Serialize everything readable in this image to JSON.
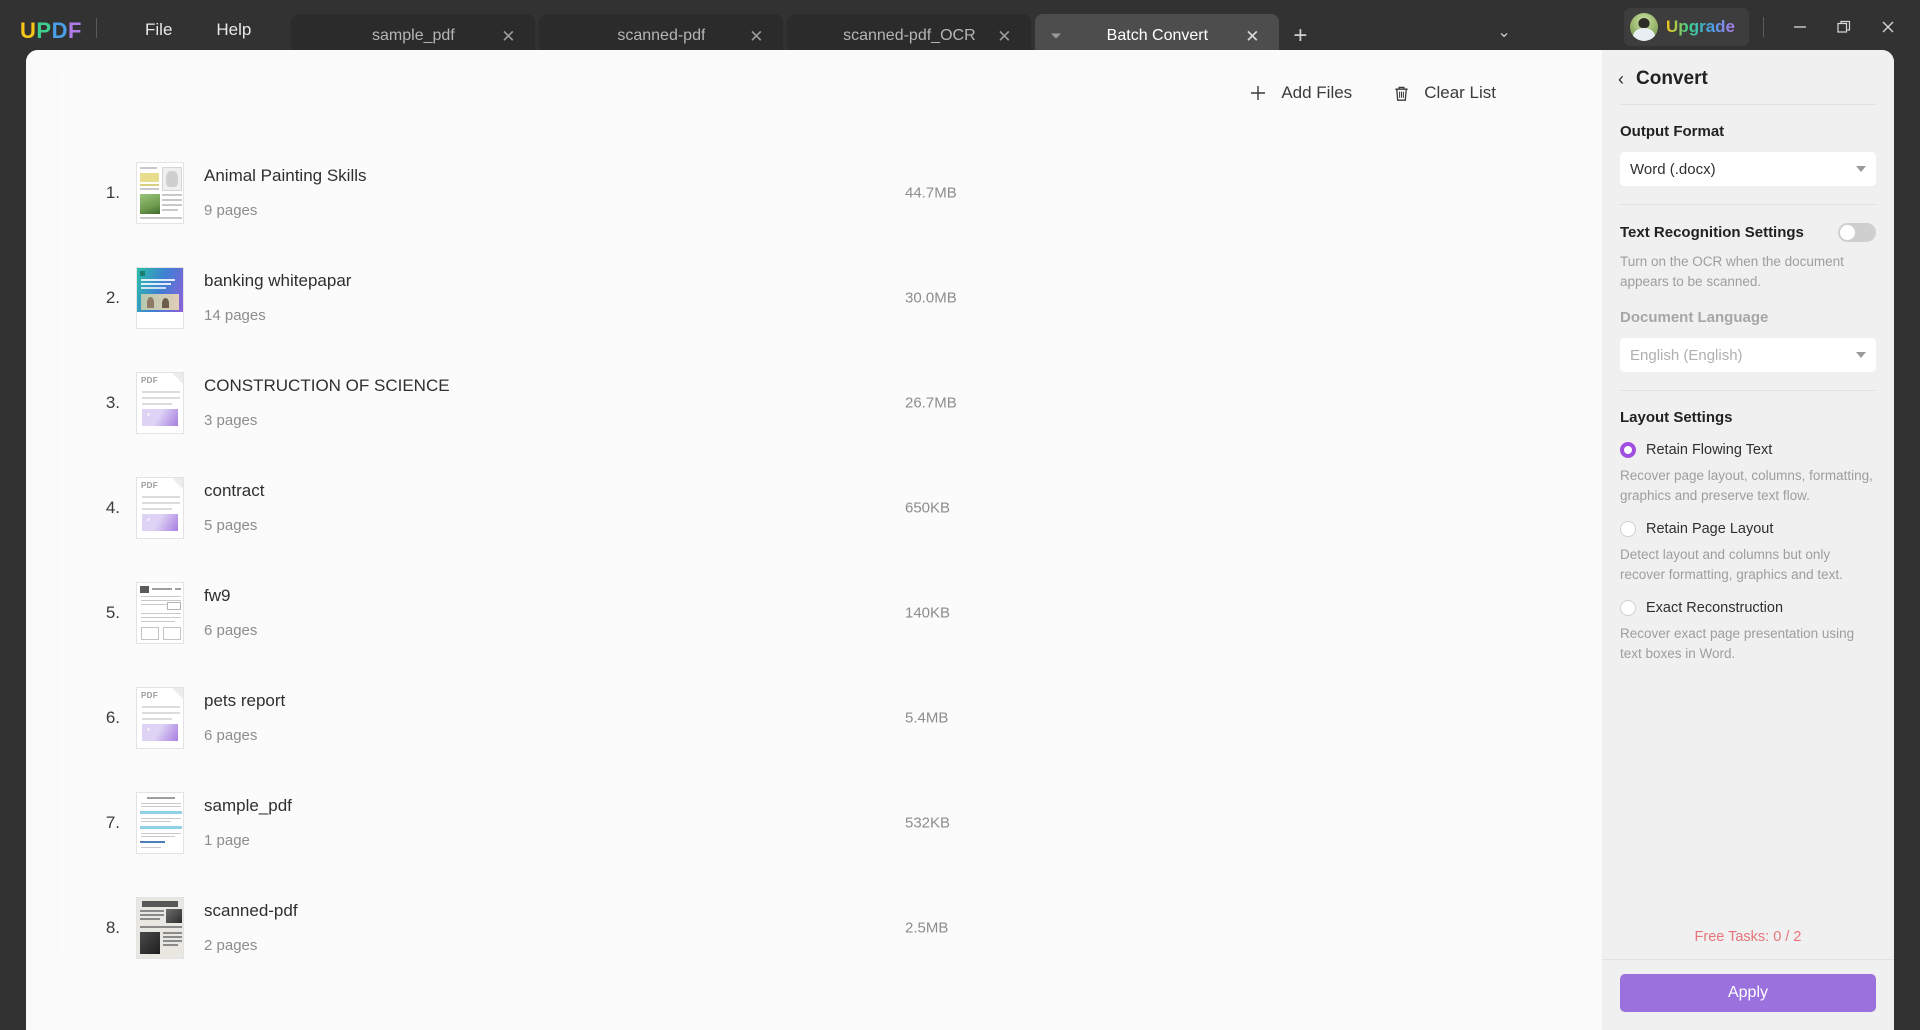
{
  "app": {
    "logo_letters": [
      "U",
      "P",
      "D",
      "F"
    ],
    "menu": [
      {
        "label": "File"
      },
      {
        "label": "Help"
      }
    ],
    "tabs": [
      {
        "label": "sample_pdf",
        "active": false,
        "close_icon": "✕"
      },
      {
        "label": "scanned-pdf",
        "active": false,
        "close_icon": "✕"
      },
      {
        "label": "scanned-pdf_OCR",
        "active": false,
        "close_icon": "✕"
      },
      {
        "label": "Batch Convert",
        "active": true,
        "close_icon": "✕"
      }
    ],
    "new_tab_icon": "+",
    "tab_list_icon": "⌄",
    "upgrade_label": "Upgrade",
    "window_controls": {
      "minimize": "—",
      "maximize": "❐",
      "close": "✕"
    }
  },
  "toolbar": {
    "add_files_label": "Add Files",
    "add_files_icon": "+",
    "clear_list_label": "Clear List",
    "clear_list_icon": "trash-icon"
  },
  "files": [
    {
      "index": "1.",
      "name": "Animal Painting Skills",
      "pages": "9 pages",
      "size": "44.7MB",
      "thumb": "photo-animal"
    },
    {
      "index": "2.",
      "name": "banking whitepapar",
      "pages": "14 pages",
      "size": "30.0MB",
      "thumb": "photo-banking"
    },
    {
      "index": "3.",
      "name": "CONSTRUCTION OF SCIENCE",
      "pages": "3 pages",
      "size": "26.7MB",
      "thumb": "pdf"
    },
    {
      "index": "4.",
      "name": "contract",
      "pages": "5 pages",
      "size": "650KB",
      "thumb": "pdf"
    },
    {
      "index": "5.",
      "name": "fw9",
      "pages": "6 pages",
      "size": "140KB",
      "thumb": "doc-form"
    },
    {
      "index": "6.",
      "name": "pets report",
      "pages": "6 pages",
      "size": "5.4MB",
      "thumb": "pdf"
    },
    {
      "index": "7.",
      "name": "sample_pdf",
      "pages": "1 page",
      "size": "532KB",
      "thumb": "doc-sample"
    },
    {
      "index": "8.",
      "name": "scanned-pdf",
      "pages": "2 pages",
      "size": "2.5MB",
      "thumb": "photo-scanned"
    }
  ],
  "panel": {
    "back_icon": "‹",
    "title": "Convert",
    "output_format": {
      "label": "Output Format",
      "value": "Word (.docx)"
    },
    "text_recognition": {
      "label": "Text Recognition Settings",
      "enabled": false,
      "description": "Turn on the OCR when the document appears to be scanned."
    },
    "document_language": {
      "label": "Document Language",
      "value": "English (English)",
      "disabled": true
    },
    "layout_settings": {
      "label": "Layout Settings",
      "options": [
        {
          "label": "Retain Flowing Text",
          "selected": true,
          "description": "Recover page layout, columns, formatting, graphics and preserve text flow."
        },
        {
          "label": "Retain Page Layout",
          "selected": false,
          "description": "Detect layout and columns but only recover formatting, graphics and text."
        },
        {
          "label": "Exact Reconstruction",
          "selected": false,
          "description": "Recover exact page presentation using text boxes in Word."
        }
      ]
    },
    "free_tasks": "Free Tasks: 0 / 2",
    "apply_label": "Apply"
  },
  "colors": {
    "accent_purple": "#9b72dd",
    "radio_purple": "#a14fe0",
    "free_tasks_red": "#e8747c",
    "titlebar_bg": "#323232",
    "panel_bg": "#f0f0f0"
  }
}
